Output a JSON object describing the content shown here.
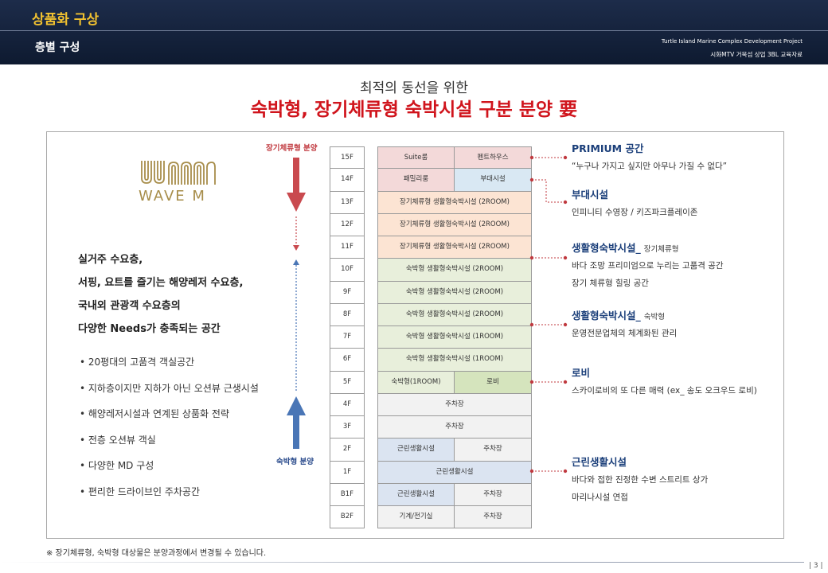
{
  "header": {
    "title": "상품화 구상",
    "subtitle": "층별 구성",
    "project": "Turtle Island Marine Complex Development Project",
    "project_sub": "시화MTV 거북섬 상업 3BL 교육자료"
  },
  "headline": {
    "pre": "최적의 동선을 위한",
    "main": "숙박형, 장기체류형 숙박시설 구분 분양 要"
  },
  "logo": {
    "text": "WAVE M"
  },
  "demand": {
    "lines": [
      "실거주 수요층,",
      "서핑, 요트를 즐기는 해양레저 수요층,",
      "국내외 관광객 수요층의",
      "다양한 Needs가 충족되는 공간"
    ]
  },
  "bullets": [
    "• 20평대의 고품격 객실공간",
    "• 지하층이지만 지하가 아닌 오션뷰 근생시설",
    "• 해양레저시설과 연계된 상품화 전략",
    "• 전층 오션뷰 객실",
    "• 다양한 MD 구성",
    "• 편리한 드라이브인 주차공간"
  ],
  "arrows": {
    "long_stay_label": "장기체류형 분양",
    "short_stay_label": "숙박형 분양",
    "colors": {
      "long": "#c0393f",
      "short": "#4a76b6"
    }
  },
  "floors": [
    "15F",
    "14F",
    "13F",
    "12F",
    "11F",
    "10F",
    "9F",
    "8F",
    "7F",
    "6F",
    "5F",
    "4F",
    "3F",
    "2F",
    "1F",
    "B1F",
    "B2F"
  ],
  "floor_rows": [
    [
      {
        "t": "Suite룸",
        "c": "c-pink"
      },
      {
        "t": "펜트하우스",
        "c": "c-pink"
      }
    ],
    [
      {
        "t": "패밀리룸",
        "c": "c-pink"
      },
      {
        "t": "부대시설",
        "c": "c-blue"
      }
    ],
    [
      {
        "t": "장기체류형 생활형숙박시설 (2ROOM)",
        "c": "c-peach"
      }
    ],
    [
      {
        "t": "장기체류형 생활형숙박시설 (2ROOM)",
        "c": "c-peach"
      }
    ],
    [
      {
        "t": "장기체류형 생활형숙박시설 (2ROOM)",
        "c": "c-peach"
      }
    ],
    [
      {
        "t": "숙박형 생활형숙박시설 (2ROOM)",
        "c": "c-green"
      }
    ],
    [
      {
        "t": "숙박형 생활형숙박시설 (2ROOM)",
        "c": "c-green"
      }
    ],
    [
      {
        "t": "숙박형 생활형숙박시설 (2ROOM)",
        "c": "c-green"
      }
    ],
    [
      {
        "t": "숙박형 생활형숙박시설 (1ROOM)",
        "c": "c-green"
      }
    ],
    [
      {
        "t": "숙박형 생활형숙박시설 (1ROOM)",
        "c": "c-green"
      }
    ],
    [
      {
        "t": "숙박형(1ROOM)",
        "c": "c-green"
      },
      {
        "t": "로비",
        "c": "c-green2"
      }
    ],
    [
      {
        "t": "주차장",
        "c": "c-gray"
      }
    ],
    [
      {
        "t": "주차장",
        "c": "c-gray"
      }
    ],
    [
      {
        "t": "근린생활시설",
        "c": "c-lblue"
      },
      {
        "t": "주차장",
        "c": "c-gray"
      }
    ],
    [
      {
        "t": "근린생활시설",
        "c": "c-lblue"
      }
    ],
    [
      {
        "t": "근린생활시설",
        "c": "c-lblue"
      },
      {
        "t": "주차장",
        "c": "c-gray"
      }
    ],
    [
      {
        "t": "기계/전기실",
        "c": "c-gray"
      },
      {
        "t": "주차장",
        "c": "c-gray"
      }
    ]
  ],
  "annotations": [
    {
      "title": "PRIMIUM 공간",
      "sub": "",
      "lines": [
        "“누구나 가지고 싶지만 아무나 가질 수 없다”"
      ]
    },
    {
      "title": "부대시설",
      "sub": "",
      "lines": [
        "인피니티 수영장 / 키즈파크플레이존"
      ]
    },
    {
      "title": "생활형숙박시설_",
      "sub": "장기체류형",
      "lines": [
        "바다 조망 프리미엄으로 누리는 고품격 공간",
        "장기 체류형 힐링 공간"
      ]
    },
    {
      "title": "생활형숙박시설_",
      "sub": "숙박형",
      "lines": [
        "운영전문업체의 체계화된 관리"
      ]
    },
    {
      "title": "로비",
      "sub": "",
      "lines": [
        "스카이로비의 또 다른 매력 (ex_ 송도 오크우드 로비)"
      ]
    },
    {
      "title": "근린생활시설",
      "sub": "",
      "lines": [
        "바다와 접한 진정한 수변 스트리트 상가",
        "마리나시설 연접"
      ]
    }
  ],
  "footnote": "※ 장기체류형, 숙박형 대상물은 분양과정에서 변경될 수 있습니다.",
  "page_number": "| 3 |"
}
